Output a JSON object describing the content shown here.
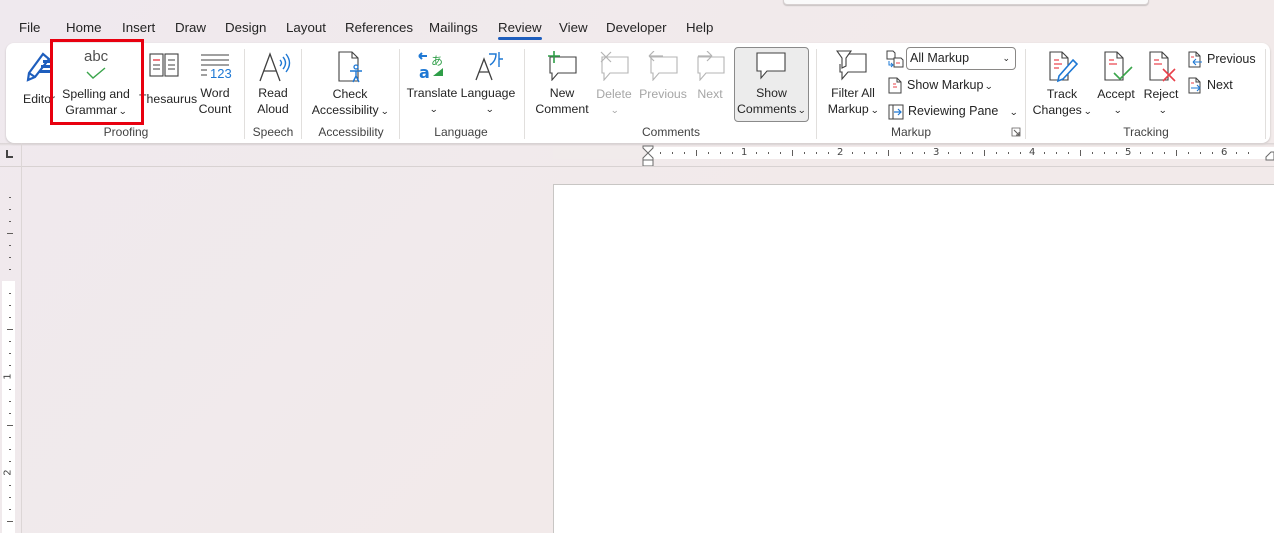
{
  "window": {
    "search_box": ""
  },
  "tabs": [
    {
      "label": "File"
    },
    {
      "label": "Home"
    },
    {
      "label": "Insert"
    },
    {
      "label": "Draw"
    },
    {
      "label": "Design"
    },
    {
      "label": "Layout"
    },
    {
      "label": "References"
    },
    {
      "label": "Mailings"
    },
    {
      "label": "Review",
      "active": true
    },
    {
      "label": "View"
    },
    {
      "label": "Developer"
    },
    {
      "label": "Help"
    }
  ],
  "ribbon": {
    "proofing": {
      "group_label": "Proofing",
      "editor": "Editor",
      "spelling_line1": "Spelling and",
      "spelling_line2": "Grammar",
      "spelling_icon_text": "abc",
      "thesaurus": "Thesaurus",
      "word_count_line1": "Word",
      "word_count_line2": "Count",
      "word_count_icon_text": "123"
    },
    "speech": {
      "group_label": "Speech",
      "read_aloud_line1": "Read",
      "read_aloud_line2": "Aloud"
    },
    "accessibility": {
      "group_label": "Accessibility",
      "check_line1": "Check",
      "check_line2": "Accessibility"
    },
    "language": {
      "group_label": "Language",
      "translate": "Translate",
      "language": "Language"
    },
    "comments": {
      "group_label": "Comments",
      "new_line1": "New",
      "new_line2": "Comment",
      "delete": "Delete",
      "previous": "Previous",
      "next": "Next",
      "show_line1": "Show",
      "show_line2": "Comments"
    },
    "markup": {
      "group_label": "Markup",
      "filter_line1": "Filter All",
      "filter_line2": "Markup",
      "display_dropdown_value": "All Markup",
      "show_markup": "Show Markup",
      "reviewing_pane": "Reviewing Pane"
    },
    "tracking": {
      "group_label": "Tracking",
      "track_line1": "Track",
      "track_line2": "Changes",
      "accept": "Accept",
      "reject": "Reject",
      "previous": "Previous",
      "next": "Next"
    }
  },
  "ruler": {
    "horizontal_numbers": [
      "1",
      "2",
      "3",
      "4",
      "5",
      "6"
    ],
    "vertical_numbers": [
      "1",
      "2"
    ]
  },
  "colors": {
    "accent": "#1e5ebd",
    "highlight": "#e8000f",
    "blue_icon": "#1e78d4",
    "green_check": "#3aa54b",
    "red_mark": "#e8404a"
  }
}
